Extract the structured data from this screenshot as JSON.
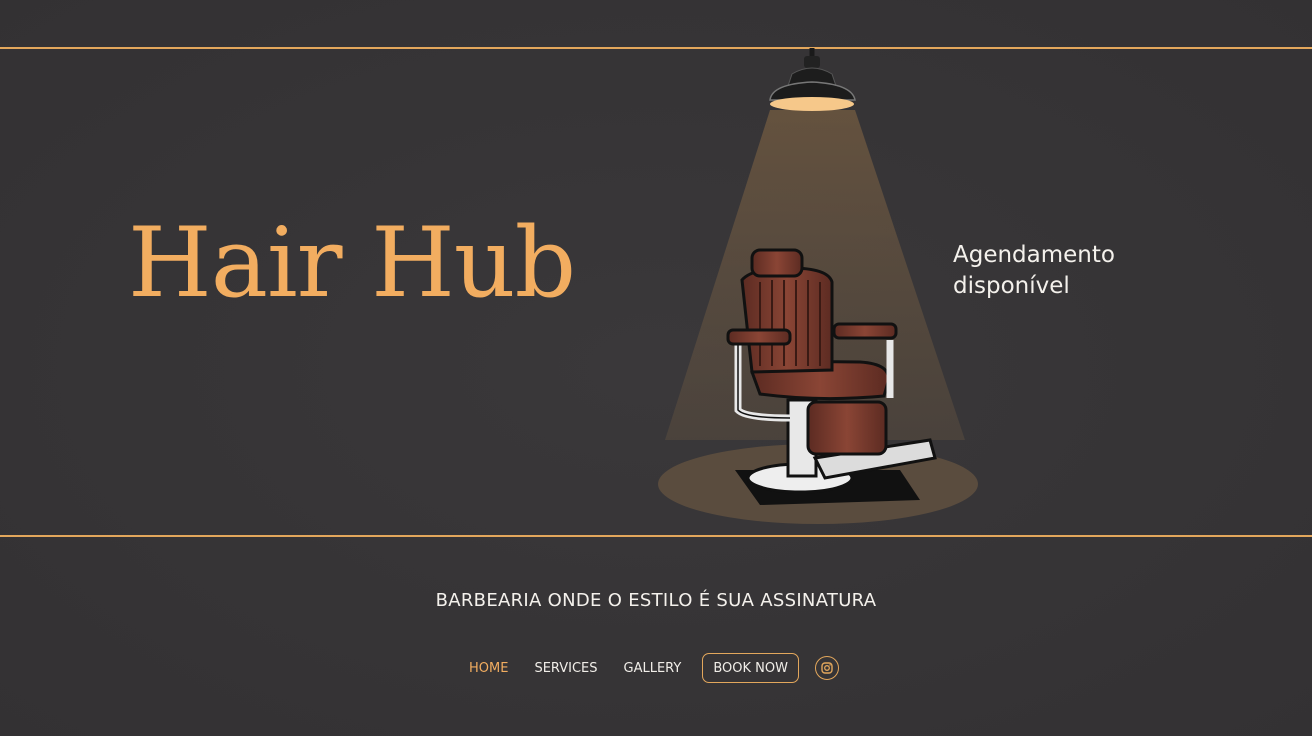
{
  "hero": {
    "title": "Hair Hub",
    "side_note": "Agendamento disponível"
  },
  "tagline": "BARBEARIA ONDE O ESTILO É SUA ASSINATURA",
  "nav": {
    "items": [
      {
        "label": "HOME",
        "active": true
      },
      {
        "label": "SERVICES",
        "active": false
      },
      {
        "label": "GALLERY",
        "active": false
      }
    ],
    "book_label": "BOOK NOW",
    "social_icon": "instagram-icon"
  },
  "colors": {
    "background": "#363436",
    "accent_gold": "#f2ad60",
    "line_gold": "#e3a75c",
    "text_light": "#f4f1ec",
    "chair_leather": "#7a3a2c"
  },
  "illustration": {
    "subject": "barber-chair-under-spotlight-icon"
  }
}
